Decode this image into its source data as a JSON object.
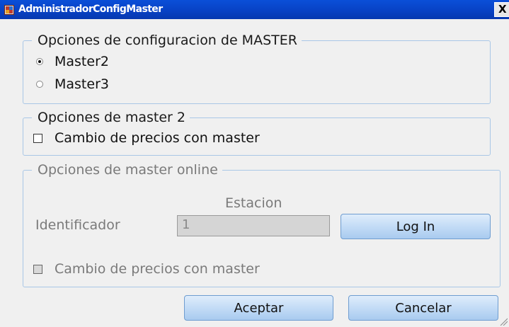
{
  "window": {
    "title": "AdministradorConfigMaster",
    "close_label": "X"
  },
  "group_master": {
    "legend": "Opciones de configuracion de MASTER",
    "options": [
      {
        "label": "Master2",
        "selected": true
      },
      {
        "label": "Master3",
        "selected": false
      }
    ]
  },
  "group_master2": {
    "legend": "Opciones de master 2",
    "checkbox_label": "Cambio de precios con master",
    "checked": false
  },
  "group_online": {
    "legend": "Opciones de master online",
    "estacion_label": "Estacion",
    "identificador_label": "Identificador",
    "identificador_value": "1",
    "login_label": "Log In",
    "checkbox_label": "Cambio de precios con master",
    "checked": false
  },
  "footer": {
    "accept_label": "Aceptar",
    "cancel_label": "Cancelar"
  }
}
